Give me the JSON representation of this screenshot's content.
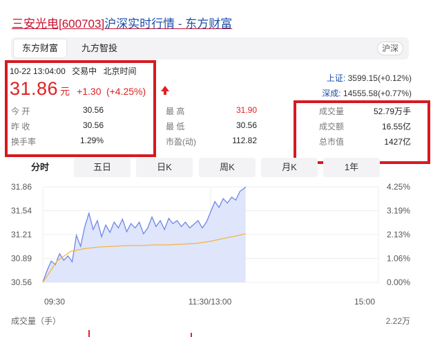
{
  "page": {
    "title_stock": "三安光电[600703]",
    "title_rest": "沪深实时行情 - 东方财富"
  },
  "tabs": {
    "sources": [
      "东方财富",
      "九方智投"
    ],
    "market_badge": "沪深"
  },
  "quote": {
    "time": "10-22 13:04:00",
    "status": "交易中",
    "timezone": "北京时间",
    "price": "31.86",
    "unit": "元",
    "change": "+1.30",
    "change_pct": "(+4.25%)",
    "arrow": "up-arrow-icon"
  },
  "indices": [
    {
      "label": "上证:",
      "value": "3599.15(+0.12%)"
    },
    {
      "label": "深成:",
      "value": "14555.58(+0.77%)"
    }
  ],
  "stats_left": [
    {
      "label": "今    开",
      "value": "30.56"
    },
    {
      "label": "昨    收",
      "value": "30.56"
    },
    {
      "label": "换手率",
      "value": "1.29%"
    }
  ],
  "stats_mid": [
    {
      "label": "最    高",
      "value": "31.90"
    },
    {
      "label": "最    低",
      "value": "30.56"
    },
    {
      "label": "市盈(动)",
      "value": "112.82"
    }
  ],
  "stats_right": [
    {
      "label": "成交量",
      "value": "52.79万手"
    },
    {
      "label": "成交额",
      "value": "16.55亿"
    },
    {
      "label": "总市值",
      "value": "1427亿"
    }
  ],
  "period_tabs": [
    "分时",
    "五日",
    "日K",
    "周K",
    "月K",
    "1年"
  ],
  "chart_data": {
    "type": "line",
    "y_left_ticks": [
      "31.86",
      "31.54",
      "31.21",
      "30.89",
      "30.56"
    ],
    "y_right_ticks": [
      "4.25%",
      "3.19%",
      "2.13%",
      "1.06%",
      "0.00%"
    ],
    "x_ticks": [
      "09:30",
      "11:30/13:00",
      "15:00"
    ],
    "ylim": [
      30.56,
      31.86
    ],
    "x_max_minutes": 240,
    "series": [
      {
        "color": "#6f86e6",
        "fill": "#dfe5fb",
        "x": [
          0,
          3,
          6,
          9,
          12,
          15,
          18,
          21,
          24,
          27,
          30,
          33,
          36,
          39,
          42,
          45,
          48,
          51,
          54,
          57,
          60,
          63,
          66,
          69,
          72,
          75,
          78,
          81,
          84,
          87,
          90,
          93,
          96,
          99,
          102,
          105,
          108,
          111,
          114,
          117,
          120,
          123,
          126,
          129,
          132,
          135,
          138,
          141,
          144,
          145
        ],
        "values": [
          30.56,
          30.72,
          30.85,
          30.8,
          30.95,
          30.86,
          30.92,
          30.84,
          31.2,
          31.05,
          31.32,
          31.5,
          31.28,
          31.4,
          31.18,
          31.34,
          31.24,
          31.38,
          31.3,
          31.42,
          31.25,
          31.36,
          31.3,
          31.38,
          31.22,
          31.3,
          31.45,
          31.32,
          31.4,
          31.28,
          31.43,
          31.36,
          31.4,
          31.32,
          31.38,
          31.3,
          31.35,
          31.4,
          31.3,
          31.38,
          31.52,
          31.66,
          31.58,
          31.7,
          31.64,
          31.72,
          31.68,
          31.8,
          31.84,
          31.86
        ]
      },
      {
        "color": "#f5b53f",
        "x": [
          0,
          5,
          10,
          20,
          30,
          40,
          50,
          60,
          70,
          80,
          90,
          100,
          110,
          120,
          130,
          140,
          145
        ],
        "values": [
          30.56,
          30.7,
          30.85,
          30.98,
          31.02,
          31.04,
          31.05,
          31.06,
          31.06,
          31.07,
          31.07,
          31.08,
          31.09,
          31.12,
          31.16,
          31.2,
          31.22
        ]
      }
    ],
    "volume_label": "成交量（手）",
    "volume_max": "2.22万"
  }
}
